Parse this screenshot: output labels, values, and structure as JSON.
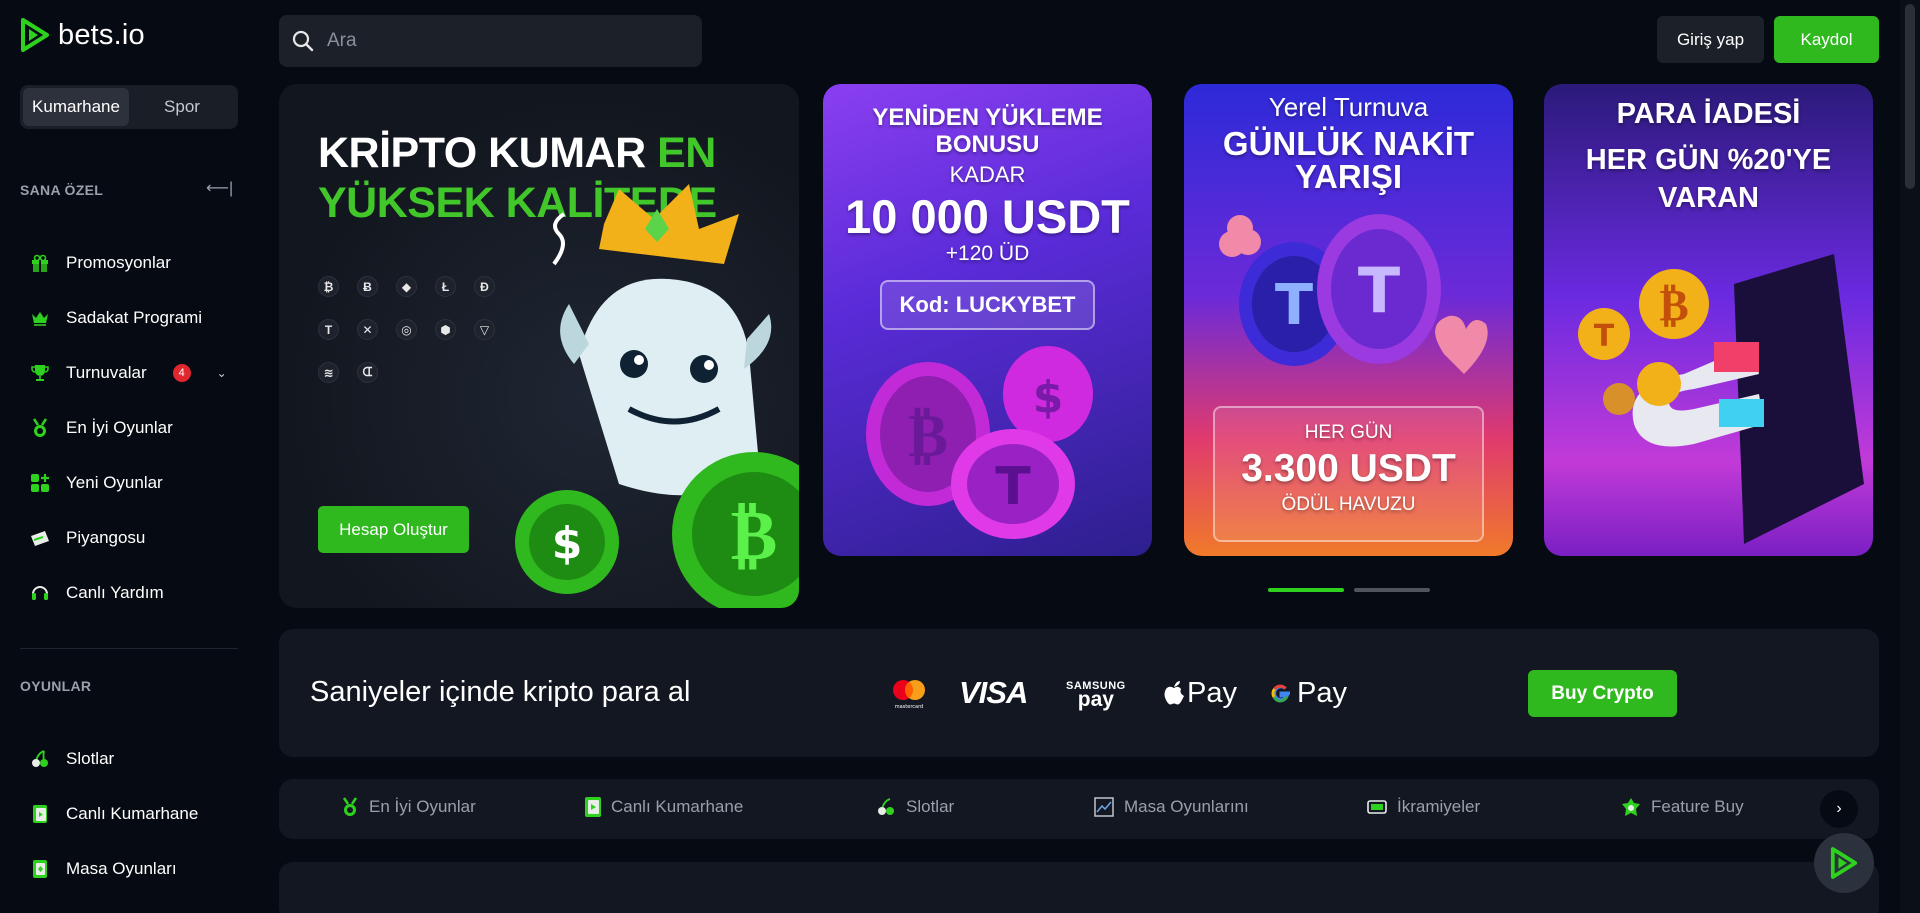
{
  "brand": {
    "name": "bets.io",
    "accent": "#2fb91f"
  },
  "sidebar": {
    "tabs": [
      "Kumarhane",
      "Spor"
    ],
    "section_personal": "SANA ÖZEL",
    "personal_items": [
      {
        "label": "Promosyonlar",
        "icon": "gift-icon"
      },
      {
        "label": "Sadakat Programi",
        "icon": "crown-icon"
      },
      {
        "label": "Turnuvalar",
        "icon": "trophy-icon",
        "badge": "4"
      },
      {
        "label": "En İyi Oyunlar",
        "icon": "medal-icon"
      },
      {
        "label": "Yeni Oyunlar",
        "icon": "new-games-icon"
      },
      {
        "label": "Piyangosu",
        "icon": "ticket-icon"
      },
      {
        "label": "Canlı Yardım",
        "icon": "headset-icon"
      }
    ],
    "section_games": "OYUNLAR",
    "game_items": [
      {
        "label": "Slotlar",
        "icon": "cherry-icon"
      },
      {
        "label": "Canlı Kumarhane",
        "icon": "live-casino-icon"
      },
      {
        "label": "Masa Oyunları",
        "icon": "cards-icon"
      }
    ]
  },
  "header": {
    "search_placeholder": "Ara",
    "login": "Giriş yap",
    "register": "Kaydol"
  },
  "hero": {
    "title_white": "KRİPTO KUMAR ",
    "title_green_1": "EN",
    "title_green_2": "YÜKSEK KALİTEDE",
    "coins_row1": [
      "₿",
      "Ƀ",
      "◆",
      "Ł",
      "Đ"
    ],
    "coins_row2": [
      "T",
      "✕",
      "◎",
      "⬢",
      "▽"
    ],
    "coins_row3": [
      "≋",
      "ᗭ"
    ],
    "cta": "Hesap Oluştur"
  },
  "promos": [
    {
      "line1": "YENİDEN YÜKLEME",
      "line2": "BONUSU",
      "line3": "KADAR",
      "amount": "10 000 USDT",
      "extra": "+120 ÜD",
      "code": "Kod: LUCKYBET"
    },
    {
      "line1": "Yerel Turnuva",
      "line2": "GÜNLÜK NAKİT",
      "line3": "YARIŞI",
      "pool_label": "HER GÜN",
      "pool_amount": "3.300 USDT",
      "pool_sub": "ÖDÜL HAVUZU"
    },
    {
      "line1": "PARA İADESİ",
      "line2": "HER GÜN %20'YE",
      "line3": "VARAN"
    }
  ],
  "buy": {
    "text": "Saniyeler içinde kripto para al",
    "mastercard": "mastercard",
    "visa": "VISA",
    "samsung_top": "SAMSUNG",
    "samsung_bottom": "pay",
    "apple": "Pay",
    "google": "Pay",
    "button": "Buy Crypto"
  },
  "categories": [
    {
      "label": "En İyi Oyunlar",
      "icon": "medal-icon"
    },
    {
      "label": "Canlı Kumarhane",
      "icon": "live-casino-icon"
    },
    {
      "label": "Slotlar",
      "icon": "cherry-icon"
    },
    {
      "label": "Masa Oyunlarını",
      "icon": "table-games-icon"
    },
    {
      "label": "İkramiyeler",
      "icon": "jackpot-icon"
    },
    {
      "label": "Feature Buy",
      "icon": "feature-buy-icon"
    }
  ]
}
